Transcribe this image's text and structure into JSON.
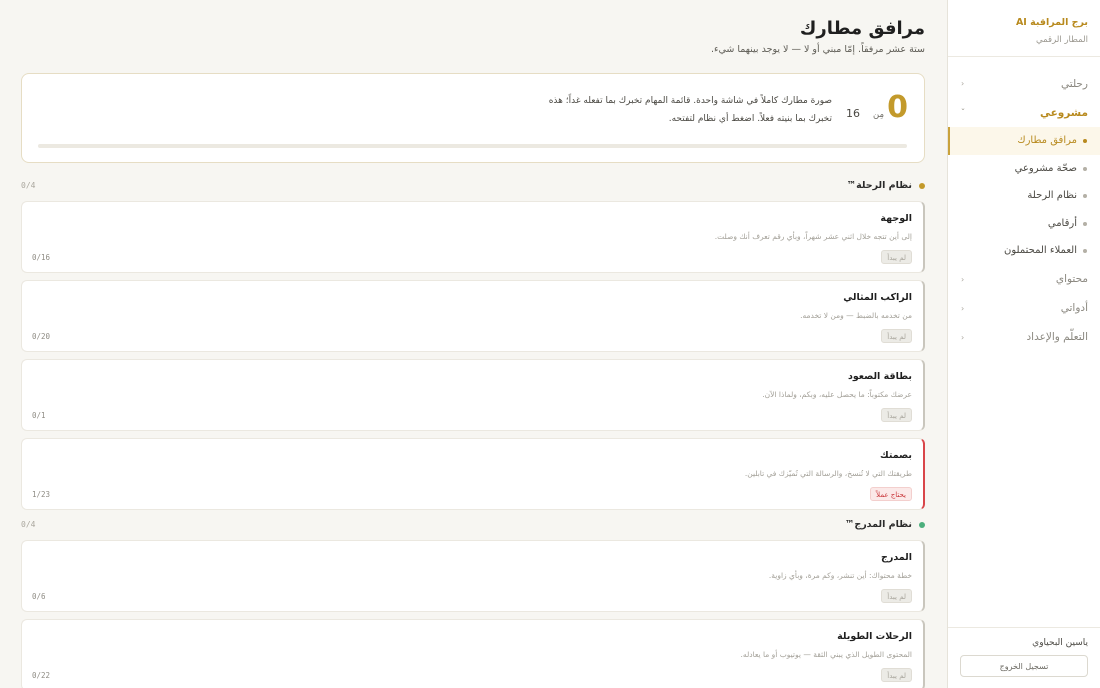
{
  "sidebar": {
    "brand_title": "برج المراقبة AI",
    "brand_subtitle": "المطار الرقمي",
    "groups": [
      {
        "label": "رحلتي"
      },
      {
        "label": "مشروعي",
        "items": [
          {
            "label": "مرافق مطارك"
          },
          {
            "label": "صحّة مشروعي"
          },
          {
            "label": "نظام الرحلة"
          },
          {
            "label": "أرقامي"
          },
          {
            "label": "العملاء المحتملون"
          }
        ]
      },
      {
        "label": "محتواي"
      },
      {
        "label": "أدواتي"
      },
      {
        "label": "التعلّم والإعداد"
      }
    ],
    "user_name": "ياسين البحياوي",
    "logout_label": "تسجيل الخروج"
  },
  "header": {
    "title": "مرافق مطارك",
    "subtitle": "ستة عشر مرفقاً. إمّا مبني أو لا — لا يوجد بينهما شيء."
  },
  "summary": {
    "completed": "0",
    "of_label": "مِن",
    "total": "16",
    "desc_line1": "صورة مطارك كاملاً في شاشة واحدة. قائمة المهام تخبرك بما تفعله غداً؛ هذه",
    "desc_line2": "تخبرك بما بنيته فعلاً. اضغط أي نظام لتفتحه.",
    "progress": 0
  },
  "sections": [
    {
      "title": "نظام الرحلة™",
      "count": "0/4",
      "color": "#c39a2b",
      "cards": [
        {
          "title": "الوجهة",
          "desc": "إلى أين تتجه خلال اثني عشر شهراً، وبأي رقم تعرف أنك وصلت.",
          "badge": "لم يبدأ",
          "count": "0/16",
          "alert": false
        },
        {
          "title": "الراكب المثالي",
          "desc": "من تخدمه بالضبط — ومن لا تخدمه.",
          "badge": "لم يبدأ",
          "count": "0/20",
          "alert": false
        },
        {
          "title": "بطاقة الصعود",
          "desc": "عرضك مكتوباً: ما يحصل عليه، وبكم، ولماذا الآن.",
          "badge": "لم يبدأ",
          "count": "0/1",
          "alert": false
        },
        {
          "title": "بصمتك",
          "desc": "طريقتك التي لا تُنسخ، والرسالة التي تُميّزك في تابلين.",
          "badge": "يحتاج عملاً",
          "count": "1/23",
          "alert": true
        }
      ]
    },
    {
      "title": "نظام المدرج™",
      "count": "0/4",
      "color": "#4caf7d",
      "cards": [
        {
          "title": "المدرج",
          "desc": "خطة محتواك: أين تنشر، وكم مرة، وبأي زاوية.",
          "badge": "لم يبدأ",
          "count": "0/6",
          "alert": false
        },
        {
          "title": "الرحلات الطويلة",
          "desc": "المحتوى الطويل الذي يبني الثقة — يوتيوب أو ما يعادله.",
          "badge": "لم يبدأ",
          "count": "0/22",
          "alert": false
        }
      ]
    }
  ]
}
